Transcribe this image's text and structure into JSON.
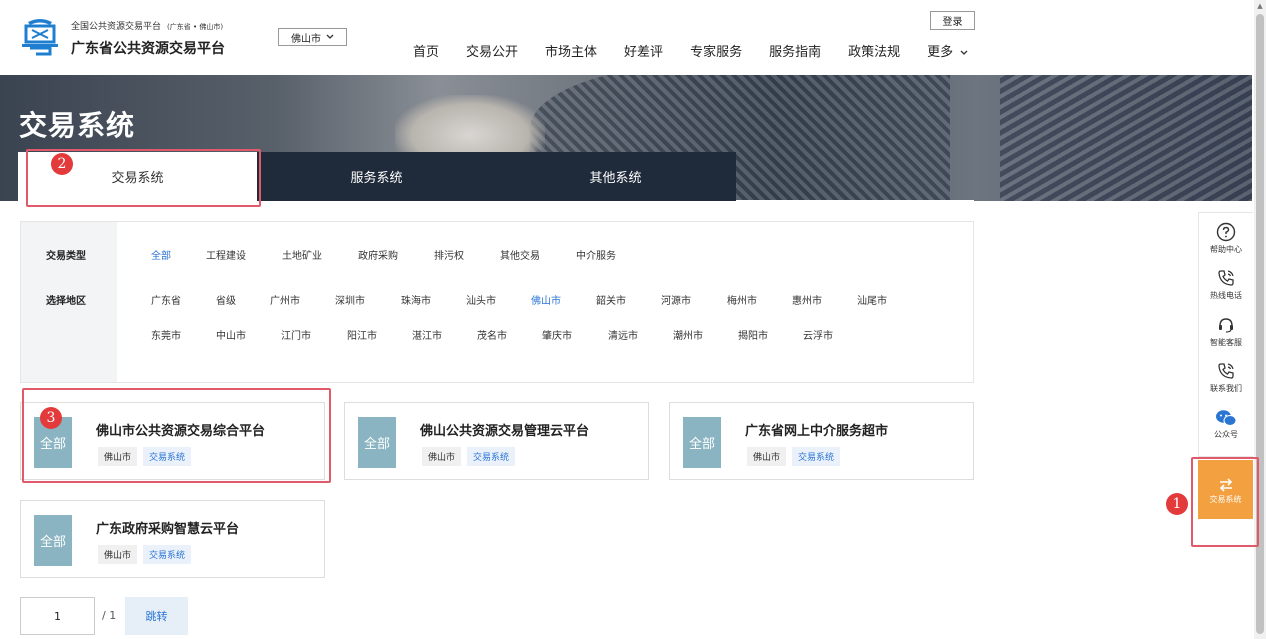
{
  "header": {
    "site_subtitle": "全国公共资源交易平台",
    "site_subtitle_region": "(广东省 • 佛山市)",
    "site_title": "广东省公共资源交易平台",
    "city_select": "佛山市",
    "login": "登录",
    "nav": [
      "首页",
      "交易公开",
      "市场主体",
      "好差评",
      "专家服务",
      "服务指南",
      "政策法规",
      "更多"
    ]
  },
  "banner": {
    "title": "交易系统",
    "tabs": [
      "交易系统",
      "服务系统",
      "其他系统"
    ]
  },
  "filters": {
    "type_label": "交易类型",
    "types": [
      "全部",
      "工程建设",
      "土地矿业",
      "政府采购",
      "排污权",
      "其他交易",
      "中介服务"
    ],
    "region_label": "选择地区",
    "regions_row1": [
      "广东省",
      "省级",
      "广州市",
      "深圳市",
      "珠海市",
      "汕头市",
      "佛山市",
      "韶关市",
      "河源市",
      "梅州市",
      "惠州市",
      "汕尾市"
    ],
    "regions_row2": [
      "东莞市",
      "中山市",
      "江门市",
      "阳江市",
      "湛江市",
      "茂名市",
      "肇庆市",
      "清远市",
      "潮州市",
      "揭阳市",
      "云浮市"
    ]
  },
  "cards": [
    {
      "badge": "全部",
      "title": "佛山市公共资源交易综合平台",
      "city": "佛山市",
      "tag": "交易系统"
    },
    {
      "badge": "全部",
      "title": "佛山公共资源交易管理云平台",
      "city": "佛山市",
      "tag": "交易系统"
    },
    {
      "badge": "全部",
      "title": "广东省网上中介服务超市",
      "city": "佛山市",
      "tag": "交易系统"
    },
    {
      "badge": "全部",
      "title": "广东政府采购智慧云平台",
      "city": "佛山市",
      "tag": "交易系统"
    }
  ],
  "pagination": {
    "current": "1",
    "total": "/ 1",
    "jump": "跳转"
  },
  "side_panel": {
    "items": [
      "帮助中心",
      "热线电话",
      "智能客服",
      "联系我们",
      "公众号"
    ],
    "trade": "交易系统"
  },
  "annotations": [
    "1",
    "2",
    "3"
  ],
  "colors": {
    "accent_blue": "#2a74d4",
    "tab_dark": "#1f2a3a",
    "badge": "#8ab4c2",
    "side_orange": "#f3a040",
    "annotation_red": "#e33b3b"
  }
}
